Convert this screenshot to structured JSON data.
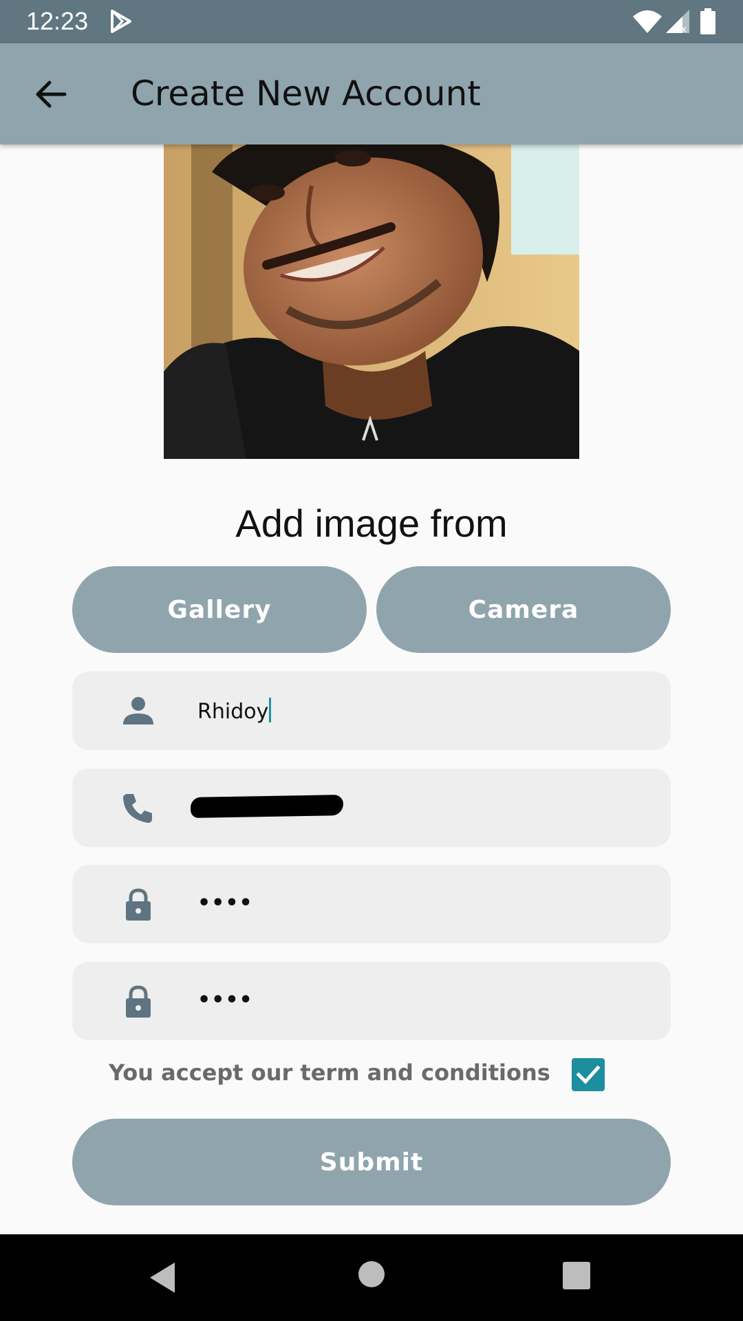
{
  "status_bar": {
    "time": "12:23",
    "icons": [
      "play-store-icon",
      "wifi-icon",
      "signal-icon",
      "battery-icon"
    ]
  },
  "app_bar": {
    "title": "Create New Account",
    "back_icon": "arrow-back-icon"
  },
  "profile": {
    "image": "profile-photo"
  },
  "image_source": {
    "title": "Add image from",
    "gallery_label": "Gallery",
    "camera_label": "Camera"
  },
  "form": {
    "name": {
      "value": "Rhidoy",
      "icon": "person-icon"
    },
    "phone": {
      "value": "",
      "icon": "phone-icon",
      "redacted": true
    },
    "password": {
      "value": "••••",
      "icon": "lock-icon"
    },
    "confirm_password": {
      "value": "••••",
      "icon": "lock-icon"
    }
  },
  "terms": {
    "label": "You accept our term and conditions",
    "checked": true
  },
  "submit_label": "Submit",
  "colors": {
    "status_bar": "#607680",
    "app_bar": "#90a4ae",
    "button": "#90a4ae",
    "field_bg": "#eeeeee",
    "icon": "#5f7482",
    "checkbox": "#1c8e9e"
  }
}
